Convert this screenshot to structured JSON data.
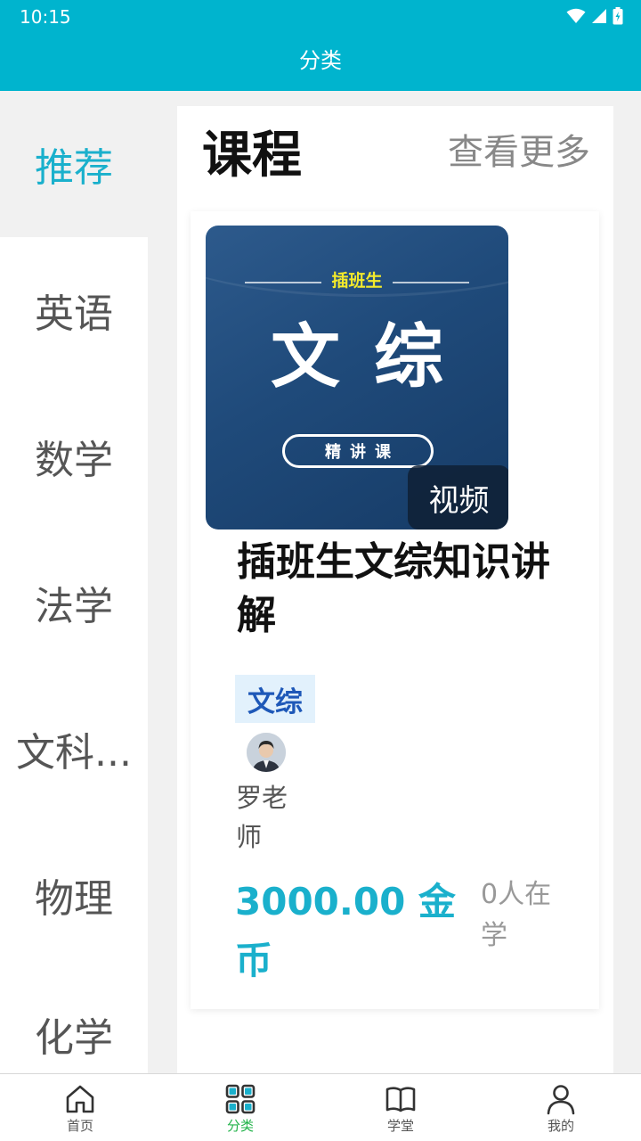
{
  "status_bar": {
    "time": "10:15"
  },
  "header": {
    "title": "分类"
  },
  "sidebar": {
    "items": [
      {
        "label": "推荐",
        "active": true
      },
      {
        "label": "英语",
        "active": false
      },
      {
        "label": "数学",
        "active": false
      },
      {
        "label": "法学",
        "active": false
      },
      {
        "label": "文科...",
        "active": false
      },
      {
        "label": "物理",
        "active": false
      },
      {
        "label": "化学",
        "active": false
      }
    ]
  },
  "section": {
    "title": "课程",
    "more_label": "查看更多"
  },
  "course": {
    "cover_subtitle": "插班生",
    "cover_title": "文综",
    "cover_badge": "精讲课",
    "media_type": "视频",
    "name": "插班生文综知识讲解",
    "tag": "文综",
    "teacher": "罗老师",
    "price": "3000.00 金币",
    "learners": "0人在学"
  },
  "bottom_nav": {
    "items": [
      {
        "label": "首页",
        "icon": "home-icon",
        "active": false
      },
      {
        "label": "分类",
        "icon": "grid-icon",
        "active": true
      },
      {
        "label": "学堂",
        "icon": "book-icon",
        "active": false
      },
      {
        "label": "我的",
        "icon": "person-icon",
        "active": false
      }
    ]
  },
  "colors": {
    "header_bg": "#00b4ce",
    "accent": "#1ab0cc",
    "nav_active": "#22b34a",
    "tag_text": "#1e58b8",
    "tag_bg": "#e2f1fc"
  }
}
